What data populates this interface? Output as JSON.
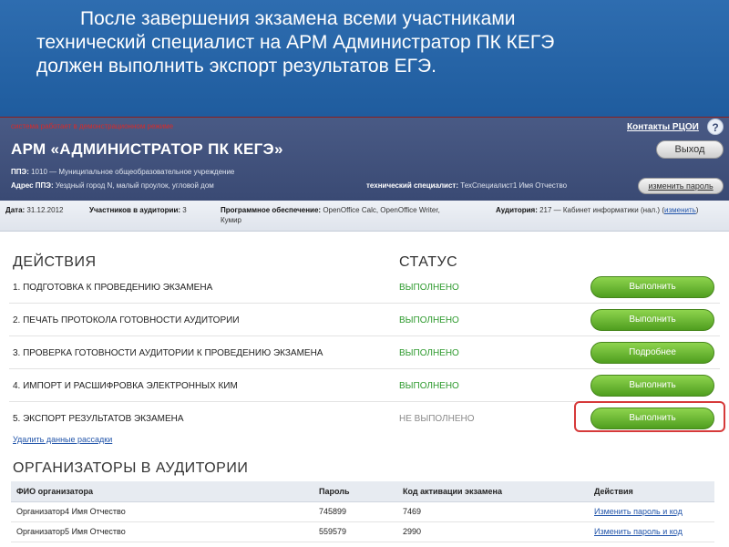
{
  "slide": {
    "lines": [
      "После завершения экзамена всеми участниками",
      "технический специалист на АРМ Администратор ПК КЕГЭ",
      "должен выполнить экспорт результатов ЕГЭ."
    ]
  },
  "header": {
    "warning": "система работает в демонстрационном режиме",
    "contacts_label": "Контакты РЦОИ",
    "help_label": "?",
    "app_title": "АРМ «АДМИНИСТРАТОР ПК КЕГЭ»",
    "logout_label": "Выход",
    "ppe_label": "ППЭ:",
    "ppe_value": "1010 — Муниципальное общеобразовательное учреждение",
    "ppe_address_label": "Адрес ППЭ:",
    "ppe_address_value": "Уездный город N, малый проулок, угловой дом",
    "spec_label": "технический специалист:",
    "spec_value": "ТехСпециалист1 Имя Отчество",
    "change_password_label": "изменить пароль"
  },
  "info": {
    "date_label": "Дата:",
    "date_value": "31.12.2012",
    "participants_label": "Участников в аудитории:",
    "participants_value": "3",
    "software_label": "Программное обеспечение:",
    "software_value_1": "OpenOffice Calc, OpenOffice Writer,",
    "software_value_2": "Кумир",
    "room_label": "Аудитория:",
    "room_value": "217 — Кабинет информатики (нал.)",
    "room_change_label": "изменить"
  },
  "actions": {
    "title": "ДЕЙСТВИЯ",
    "status_title": "СТАТУС",
    "items": [
      {
        "label": "1. ПОДГОТОВКА К ПРОВЕДЕНИЮ ЭКЗАМЕНА",
        "status": "ВЫПОЛНЕНО",
        "button": "Выполнить"
      },
      {
        "label": "2. ПЕЧАТЬ ПРОТОКОЛА ГОТОВНОСТИ АУДИТОРИИ",
        "status": "ВЫПОЛНЕНО",
        "button": "Выполнить"
      },
      {
        "label": "3. ПРОВЕРКА ГОТОВНОСТИ АУДИТОРИИ К ПРОВЕДЕНИЮ ЭКЗАМЕНА",
        "status": "ВЫПОЛНЕНО",
        "button": "Подробнее"
      },
      {
        "label": "4. ИМПОРТ И РАСШИФРОВКА ЭЛЕКТРОННЫХ КИМ",
        "status": "ВЫПОЛНЕНО",
        "button": "Выполнить"
      },
      {
        "label": "5. ЭКСПОРТ РЕЗУЛЬТАТОВ ЭКЗАМЕНА",
        "status": "НЕ ВЫПОЛНЕНО",
        "button": "Выполнить"
      }
    ],
    "delete_link": "Удалить данные рассадки"
  },
  "organizers": {
    "title": "ОРГАНИЗАТОРЫ В АУДИТОРИИ",
    "columns": [
      "ФИО организатора",
      "Пароль",
      "Код активации экзамена",
      "Действия"
    ],
    "rows": [
      {
        "name": "Организатор4 Имя Отчество",
        "password": "745899",
        "code": "7469",
        "action": "Изменить пароль и код"
      },
      {
        "name": "Организатор5 Имя Отчество",
        "password": "559579",
        "code": "2990",
        "action": "Изменить пароль и код"
      }
    ]
  },
  "colors": {
    "slide_blue": "#2e6db0",
    "app_header": "#495a85",
    "done_green": "#2e9a2e",
    "button_green": "#6cba34",
    "highlight_red": "#d63a3a"
  }
}
